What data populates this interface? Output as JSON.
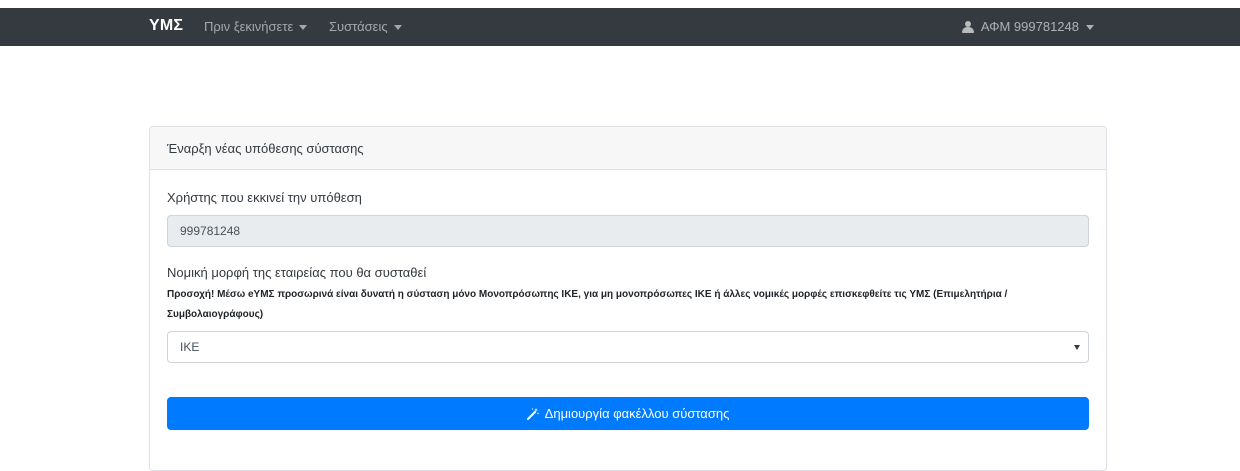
{
  "navbar": {
    "brand": "ΥΜΣ",
    "menu_before": "Πριν ξεκινήσετε",
    "menu_recommendations": "Συστάσεις",
    "user_label": "ΑΦΜ 999781248",
    "icons": {
      "caret": "caret-down-icon",
      "user": "user-icon"
    }
  },
  "card": {
    "header": "Έναρξη νέας υπόθεσης σύστασης",
    "user_label": "Χρήστης που εκκινεί την υπόθεση",
    "user_value": "999781248",
    "legal_form_label": "Νομική μορφή της εταιρείας που θα συσταθεί",
    "warning": "Προσοχή! Μέσω eΥΜΣ προσωρινά είναι δυνατή η σύσταση μόνο Μονοπρόσωπης ΙΚΕ, για μη μονοπρόσωπες ΙΚΕ ή άλλες νομικές μορφές επισκεφθείτε τις ΥΜΣ (Επιμελητήρια / Συμβολαιογράφους)",
    "legal_form_selected": "ΙΚΕ",
    "create_button": "Δημιουργία φακέλλου σύστασης",
    "create_button_icon": "magic-wand-icon"
  },
  "colors": {
    "navbar_bg": "#343a40",
    "primary": "#007bff",
    "readonly_bg": "#e9ecef",
    "card_header_bg": "#f7f7f7"
  }
}
